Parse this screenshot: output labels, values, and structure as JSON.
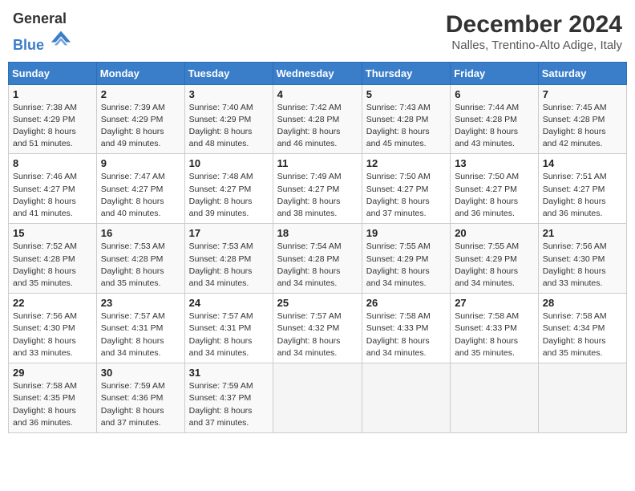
{
  "header": {
    "logo_line1": "General",
    "logo_line2": "Blue",
    "title": "December 2024",
    "subtitle": "Nalles, Trentino-Alto Adige, Italy"
  },
  "calendar": {
    "days_of_week": [
      "Sunday",
      "Monday",
      "Tuesday",
      "Wednesday",
      "Thursday",
      "Friday",
      "Saturday"
    ],
    "weeks": [
      [
        {
          "day": "1",
          "info": "Sunrise: 7:38 AM\nSunset: 4:29 PM\nDaylight: 8 hours\nand 51 minutes."
        },
        {
          "day": "2",
          "info": "Sunrise: 7:39 AM\nSunset: 4:29 PM\nDaylight: 8 hours\nand 49 minutes."
        },
        {
          "day": "3",
          "info": "Sunrise: 7:40 AM\nSunset: 4:29 PM\nDaylight: 8 hours\nand 48 minutes."
        },
        {
          "day": "4",
          "info": "Sunrise: 7:42 AM\nSunset: 4:28 PM\nDaylight: 8 hours\nand 46 minutes."
        },
        {
          "day": "5",
          "info": "Sunrise: 7:43 AM\nSunset: 4:28 PM\nDaylight: 8 hours\nand 45 minutes."
        },
        {
          "day": "6",
          "info": "Sunrise: 7:44 AM\nSunset: 4:28 PM\nDaylight: 8 hours\nand 43 minutes."
        },
        {
          "day": "7",
          "info": "Sunrise: 7:45 AM\nSunset: 4:28 PM\nDaylight: 8 hours\nand 42 minutes."
        }
      ],
      [
        {
          "day": "8",
          "info": "Sunrise: 7:46 AM\nSunset: 4:27 PM\nDaylight: 8 hours\nand 41 minutes."
        },
        {
          "day": "9",
          "info": "Sunrise: 7:47 AM\nSunset: 4:27 PM\nDaylight: 8 hours\nand 40 minutes."
        },
        {
          "day": "10",
          "info": "Sunrise: 7:48 AM\nSunset: 4:27 PM\nDaylight: 8 hours\nand 39 minutes."
        },
        {
          "day": "11",
          "info": "Sunrise: 7:49 AM\nSunset: 4:27 PM\nDaylight: 8 hours\nand 38 minutes."
        },
        {
          "day": "12",
          "info": "Sunrise: 7:50 AM\nSunset: 4:27 PM\nDaylight: 8 hours\nand 37 minutes."
        },
        {
          "day": "13",
          "info": "Sunrise: 7:50 AM\nSunset: 4:27 PM\nDaylight: 8 hours\nand 36 minutes."
        },
        {
          "day": "14",
          "info": "Sunrise: 7:51 AM\nSunset: 4:27 PM\nDaylight: 8 hours\nand 36 minutes."
        }
      ],
      [
        {
          "day": "15",
          "info": "Sunrise: 7:52 AM\nSunset: 4:28 PM\nDaylight: 8 hours\nand 35 minutes."
        },
        {
          "day": "16",
          "info": "Sunrise: 7:53 AM\nSunset: 4:28 PM\nDaylight: 8 hours\nand 35 minutes."
        },
        {
          "day": "17",
          "info": "Sunrise: 7:53 AM\nSunset: 4:28 PM\nDaylight: 8 hours\nand 34 minutes."
        },
        {
          "day": "18",
          "info": "Sunrise: 7:54 AM\nSunset: 4:28 PM\nDaylight: 8 hours\nand 34 minutes."
        },
        {
          "day": "19",
          "info": "Sunrise: 7:55 AM\nSunset: 4:29 PM\nDaylight: 8 hours\nand 34 minutes."
        },
        {
          "day": "20",
          "info": "Sunrise: 7:55 AM\nSunset: 4:29 PM\nDaylight: 8 hours\nand 34 minutes."
        },
        {
          "day": "21",
          "info": "Sunrise: 7:56 AM\nSunset: 4:30 PM\nDaylight: 8 hours\nand 33 minutes."
        }
      ],
      [
        {
          "day": "22",
          "info": "Sunrise: 7:56 AM\nSunset: 4:30 PM\nDaylight: 8 hours\nand 33 minutes."
        },
        {
          "day": "23",
          "info": "Sunrise: 7:57 AM\nSunset: 4:31 PM\nDaylight: 8 hours\nand 34 minutes."
        },
        {
          "day": "24",
          "info": "Sunrise: 7:57 AM\nSunset: 4:31 PM\nDaylight: 8 hours\nand 34 minutes."
        },
        {
          "day": "25",
          "info": "Sunrise: 7:57 AM\nSunset: 4:32 PM\nDaylight: 8 hours\nand 34 minutes."
        },
        {
          "day": "26",
          "info": "Sunrise: 7:58 AM\nSunset: 4:33 PM\nDaylight: 8 hours\nand 34 minutes."
        },
        {
          "day": "27",
          "info": "Sunrise: 7:58 AM\nSunset: 4:33 PM\nDaylight: 8 hours\nand 35 minutes."
        },
        {
          "day": "28",
          "info": "Sunrise: 7:58 AM\nSunset: 4:34 PM\nDaylight: 8 hours\nand 35 minutes."
        }
      ],
      [
        {
          "day": "29",
          "info": "Sunrise: 7:58 AM\nSunset: 4:35 PM\nDaylight: 8 hours\nand 36 minutes."
        },
        {
          "day": "30",
          "info": "Sunrise: 7:59 AM\nSunset: 4:36 PM\nDaylight: 8 hours\nand 37 minutes."
        },
        {
          "day": "31",
          "info": "Sunrise: 7:59 AM\nSunset: 4:37 PM\nDaylight: 8 hours\nand 37 minutes."
        },
        null,
        null,
        null,
        null
      ]
    ]
  }
}
